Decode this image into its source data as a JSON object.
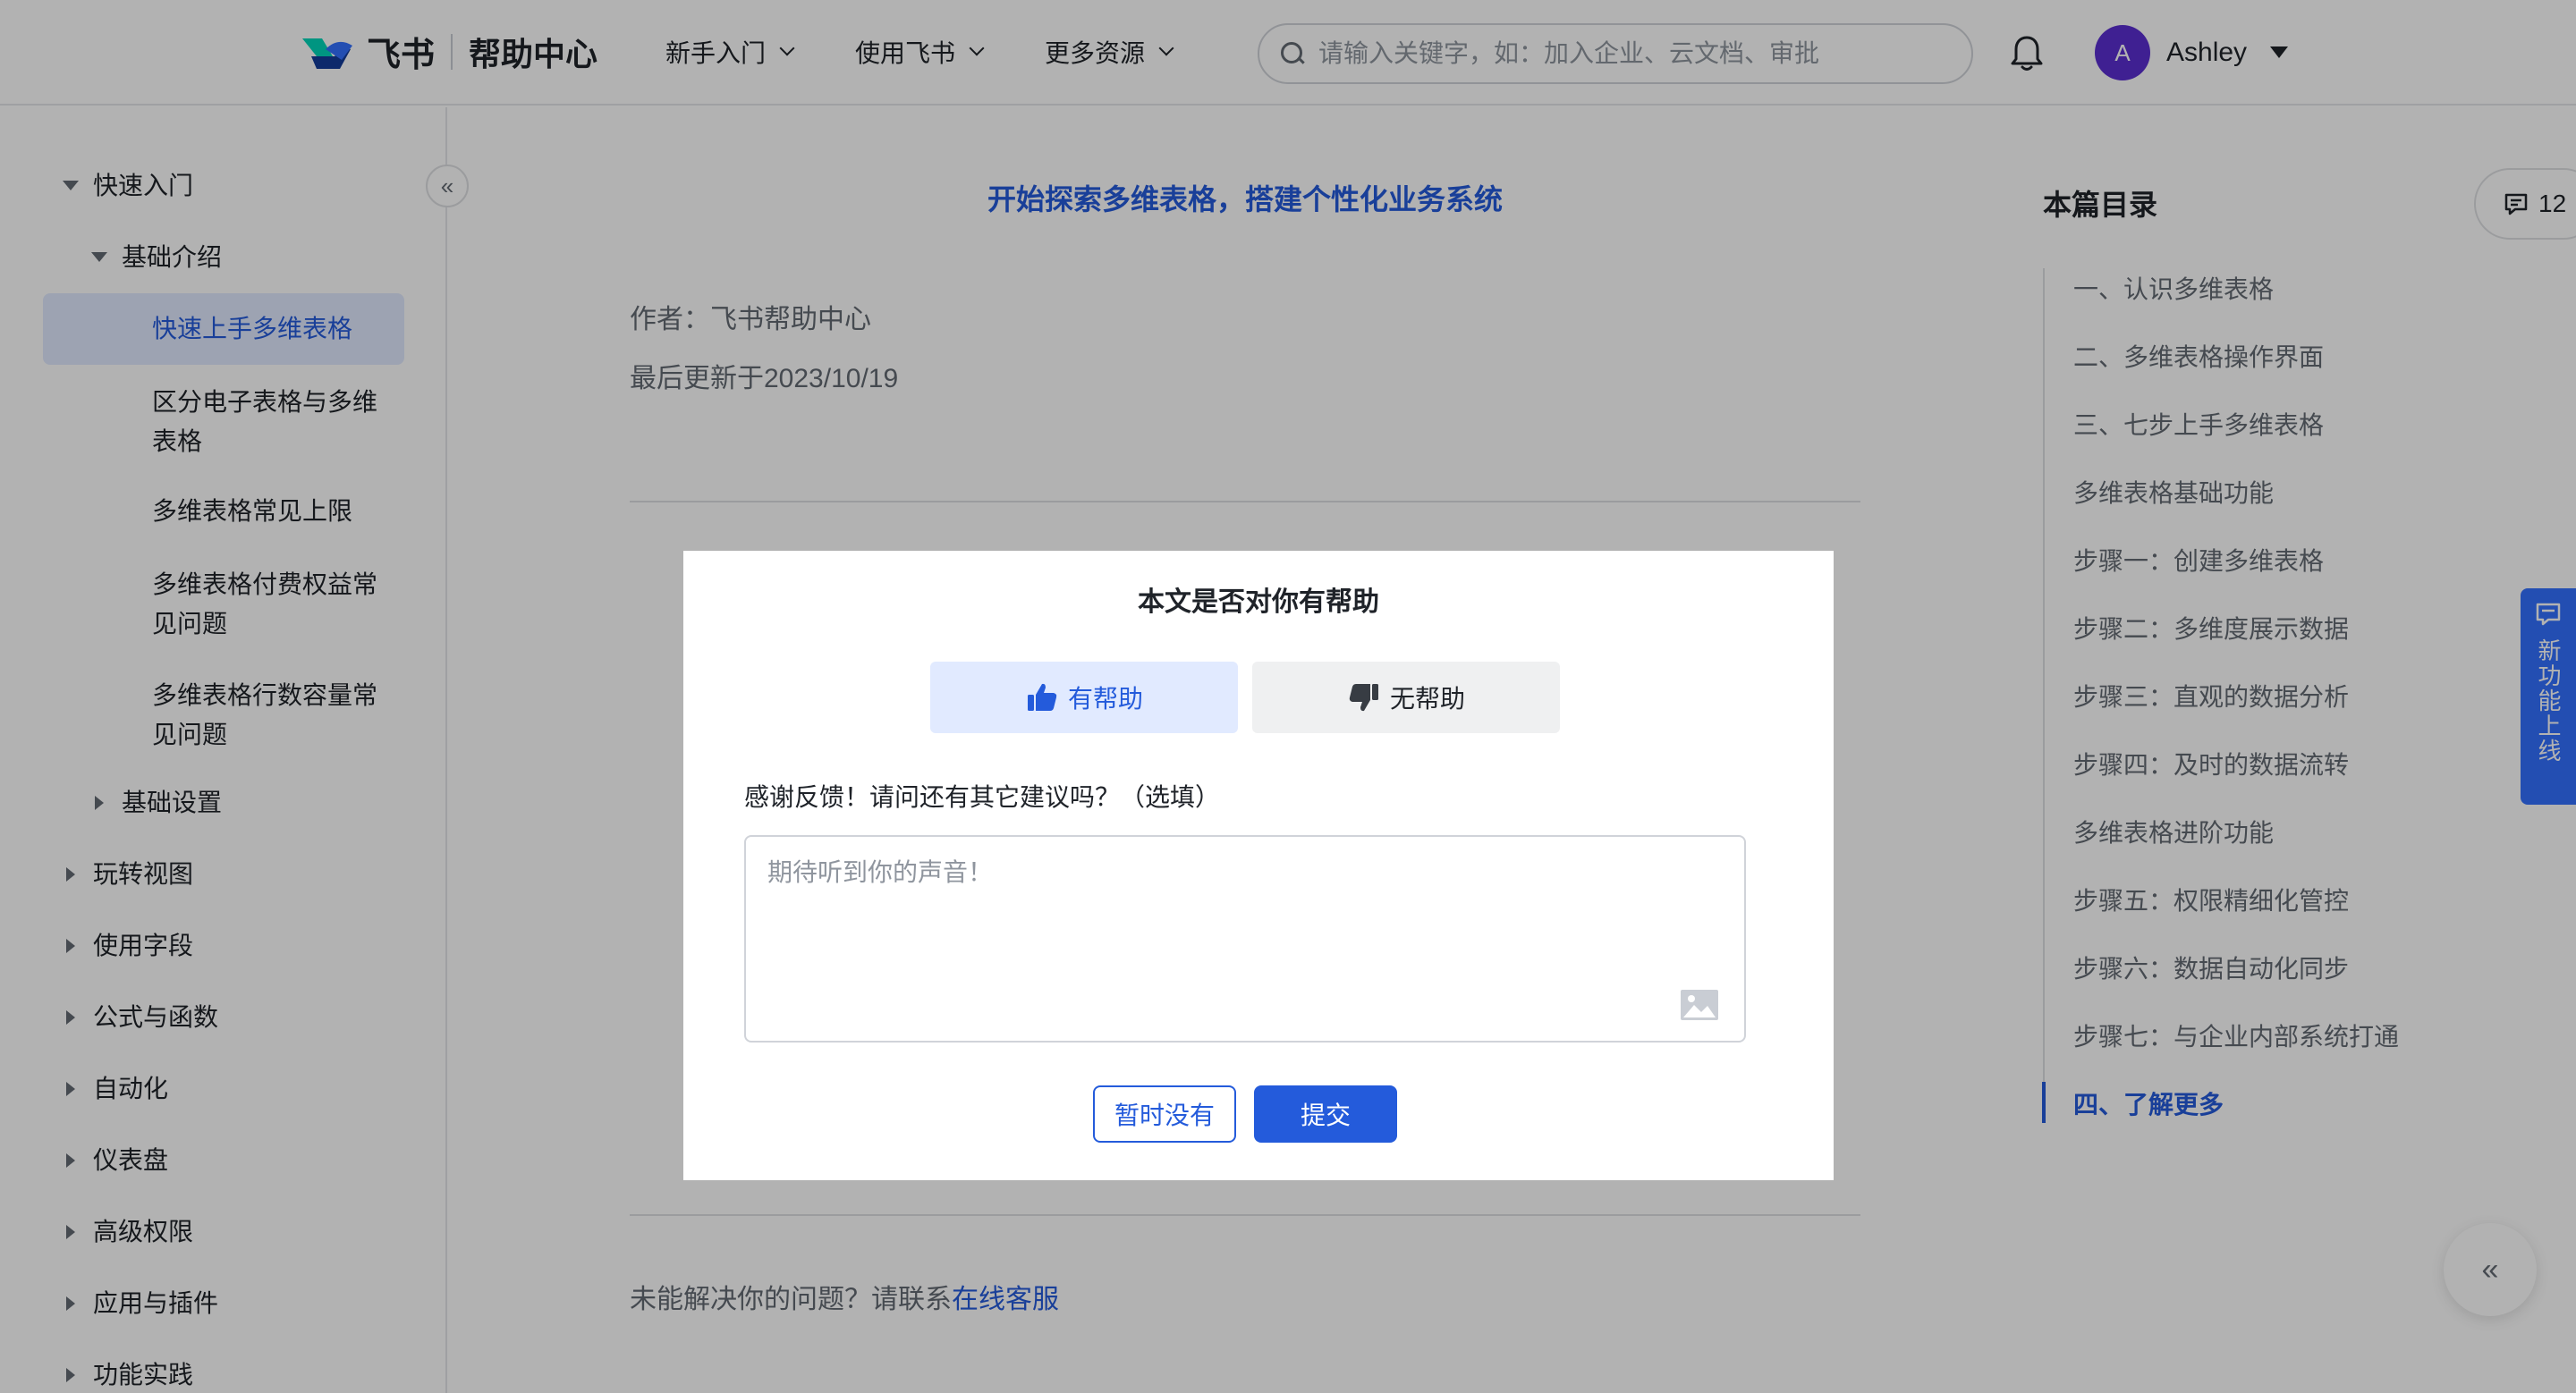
{
  "header": {
    "brand": "飞书",
    "subtitle": "帮助中心",
    "nav": [
      {
        "label": "新手入门"
      },
      {
        "label": "使用飞书"
      },
      {
        "label": "更多资源"
      }
    ],
    "search_placeholder": "请输入关键字，如：加入企业、云文档、审批",
    "user": {
      "initial": "A",
      "name": "Ashley",
      "avatar_color": "#5b2ed1"
    }
  },
  "sidebar": {
    "items": [
      {
        "label": "快速入门",
        "state": "expanded"
      },
      {
        "label": "基础介绍",
        "state": "expanded"
      },
      {
        "label": "快速上手多维表格",
        "state": "active"
      },
      {
        "label": "区分电子表格与多维表格"
      },
      {
        "label": "多维表格常见上限"
      },
      {
        "label": "多维表格付费权益常见问题"
      },
      {
        "label": "多维表格行数容量常见问题"
      },
      {
        "label": "基础设置",
        "state": "collapsed"
      },
      {
        "label": "玩转视图",
        "state": "collapsed"
      },
      {
        "label": "使用字段",
        "state": "collapsed"
      },
      {
        "label": "公式与函数",
        "state": "collapsed"
      },
      {
        "label": "自动化",
        "state": "collapsed"
      },
      {
        "label": "仪表盘",
        "state": "collapsed"
      },
      {
        "label": "高级权限",
        "state": "collapsed"
      },
      {
        "label": "应用与插件",
        "state": "collapsed"
      },
      {
        "label": "功能实践",
        "state": "collapsed"
      }
    ],
    "collapse_icon": "«"
  },
  "article": {
    "title": "开始探索多维表格，搭建个性化业务系统",
    "author": "作者：飞书帮助中心",
    "updated": "最后更新于2023/10/19",
    "unresolved_prefix": "未能解决你的问题？请联系",
    "unresolved_link": "在线客服"
  },
  "toc": {
    "title": "本篇目录",
    "items": [
      {
        "label": "一、认识多维表格"
      },
      {
        "label": "二、多维表格操作界面"
      },
      {
        "label": "三、七步上手多维表格"
      },
      {
        "label": "多维表格基础功能"
      },
      {
        "label": "步骤一：创建多维表格"
      },
      {
        "label": "步骤二：多维度展示数据"
      },
      {
        "label": "步骤三：直观的数据分析"
      },
      {
        "label": "步骤四：及时的数据流转"
      },
      {
        "label": "多维表格进阶功能"
      },
      {
        "label": "步骤五：权限精细化管控"
      },
      {
        "label": "步骤六：数据自动化同步"
      },
      {
        "label": "步骤七：与企业内部系统打通"
      },
      {
        "label": "四、了解更多",
        "active": true
      }
    ]
  },
  "side_tools": {
    "comment_count": "12",
    "new_feature": "新功能上线",
    "back_icon": "«"
  },
  "modal": {
    "title": "本文是否对你有帮助",
    "helpful": "有帮助",
    "not_helpful": "无帮助",
    "feedback_label": "感谢反馈！请问还有其它建议吗？（选填）",
    "feedback_placeholder": "期待听到你的声音！",
    "later": "暂时没有",
    "submit": "提交"
  },
  "colors": {
    "accent": "#245bdb",
    "accent_light": "#e1eaff",
    "overlay": "rgba(0,0,0,0.3)",
    "new_feature_bg": "#3370ff"
  }
}
